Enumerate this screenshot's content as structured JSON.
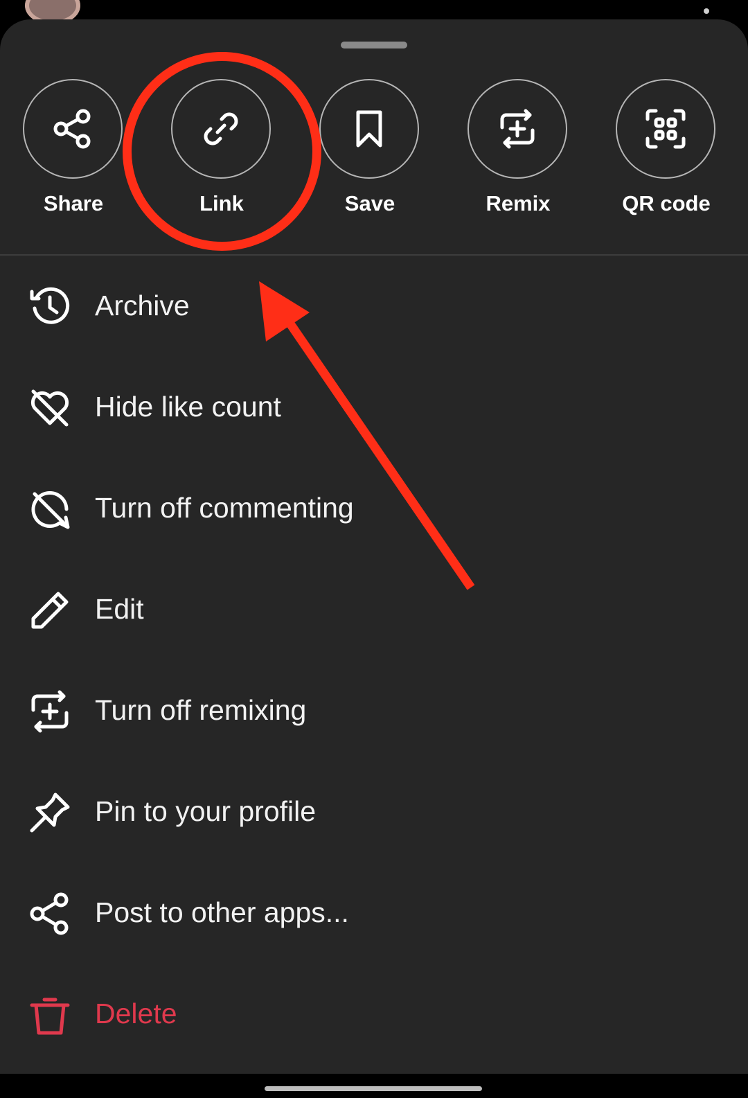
{
  "actions": [
    {
      "id": "share",
      "label": "Share",
      "icon": "share-icon"
    },
    {
      "id": "link",
      "label": "Link",
      "icon": "link-icon"
    },
    {
      "id": "save",
      "label": "Save",
      "icon": "bookmark-icon"
    },
    {
      "id": "remix",
      "label": "Remix",
      "icon": "remix-icon"
    },
    {
      "id": "qr",
      "label": "QR code",
      "icon": "qr-code-icon"
    }
  ],
  "menu": [
    {
      "id": "archive",
      "label": "Archive",
      "icon": "archive-clock-icon"
    },
    {
      "id": "hide-like-count",
      "label": "Hide like count",
      "icon": "heart-off-icon"
    },
    {
      "id": "turn-off-commenting",
      "label": "Turn off commenting",
      "icon": "comment-off-icon"
    },
    {
      "id": "edit",
      "label": "Edit",
      "icon": "pencil-icon"
    },
    {
      "id": "turn-off-remixing",
      "label": "Turn off remixing",
      "icon": "remix-icon"
    },
    {
      "id": "pin",
      "label": "Pin to your profile",
      "icon": "pin-icon"
    },
    {
      "id": "post-to-other-apps",
      "label": "Post to other apps...",
      "icon": "share-icon"
    },
    {
      "id": "delete",
      "label": "Delete",
      "icon": "trash-icon"
    }
  ],
  "colors": {
    "sheet": "#262626",
    "text": "#ffffff",
    "danger": "#e0394d",
    "annotation": "#ff2e17"
  }
}
